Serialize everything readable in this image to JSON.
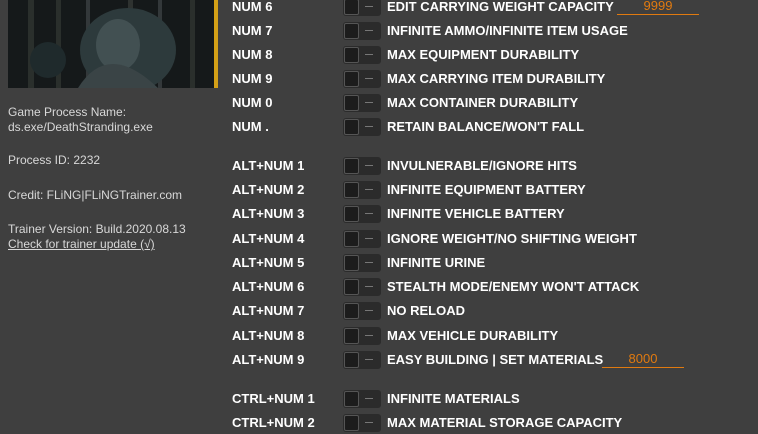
{
  "sidebar": {
    "process_name_label": "Game Process Name:",
    "process_name_value": "ds.exe/DeathStranding.exe",
    "process_id": "Process ID: 2232",
    "credit": "Credit: FLiNG|FLiNGTrainer.com",
    "version": "Trainer Version: Build.2020.08.13",
    "update_link": "Check for trainer update (√)"
  },
  "cheats": [
    {
      "key": "NUM 6",
      "label": "EDIT CARRYING WEIGHT CAPACITY",
      "value": "9999"
    },
    {
      "key": "NUM 7",
      "label": "INFINITE AMMO/INFINITE ITEM USAGE"
    },
    {
      "key": "NUM 8",
      "label": "MAX EQUIPMENT DURABILITY"
    },
    {
      "key": "NUM 9",
      "label": "MAX CARRYING ITEM DURABILITY"
    },
    {
      "key": "NUM 0",
      "label": "MAX CONTAINER DURABILITY"
    },
    {
      "key": "NUM .",
      "label": "RETAIN BALANCE/WON'T FALL"
    },
    {
      "key": "ALT+NUM 1",
      "label": "INVULNERABLE/IGNORE HITS"
    },
    {
      "key": "ALT+NUM 2",
      "label": "INFINITE EQUIPMENT BATTERY"
    },
    {
      "key": "ALT+NUM 3",
      "label": "INFINITE VEHICLE BATTERY"
    },
    {
      "key": "ALT+NUM 4",
      "label": "IGNORE WEIGHT/NO SHIFTING WEIGHT"
    },
    {
      "key": "ALT+NUM 5",
      "label": "INFINITE URINE"
    },
    {
      "key": "ALT+NUM 6",
      "label": "STEALTH MODE/ENEMY WON'T ATTACK"
    },
    {
      "key": "ALT+NUM 7",
      "label": "NO RELOAD"
    },
    {
      "key": "ALT+NUM 8",
      "label": "MAX VEHICLE DURABILITY"
    },
    {
      "key": "ALT+NUM 9",
      "label": "EASY BUILDING | SET MATERIALS",
      "value": "8000"
    },
    {
      "key": "CTRL+NUM 1",
      "label": "INFINITE MATERIALS"
    },
    {
      "key": "CTRL+NUM 2",
      "label": "MAX MATERIAL STORAGE CAPACITY"
    }
  ],
  "colors": {
    "background": "#3f3f3f",
    "accent": "#e07a10",
    "text": "#ffffff"
  }
}
